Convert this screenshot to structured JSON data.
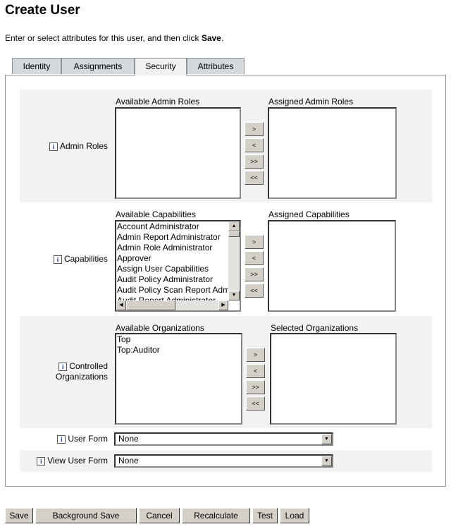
{
  "title": "Create User",
  "intro": {
    "text": "Enter or select attributes for this user, and then click ",
    "bold": "Save",
    "end": "."
  },
  "tabs": [
    {
      "label": "Identity"
    },
    {
      "label": "Assignments"
    },
    {
      "label": "Security",
      "active": true
    },
    {
      "label": "Attributes"
    }
  ],
  "admin_roles": {
    "label": "Admin Roles",
    "available_label": "Available Admin Roles",
    "assigned_label": "Assigned Admin Roles",
    "available": [],
    "assigned": []
  },
  "capabilities": {
    "label": "Capabilities",
    "available_label": "Available Capabilities",
    "assigned_label": "Assigned Capabilities",
    "available": [
      "Account Administrator",
      "Admin Report Administrator",
      "Admin Role Administrator",
      "Approver",
      "Assign User Capabilities",
      "Audit Policy Administrator",
      "Audit Policy Scan Report Administrator",
      "Audit Report Administrator"
    ],
    "assigned": []
  },
  "organizations": {
    "label1": "Controlled",
    "label2": "Organizations",
    "available_label": "Available Organizations",
    "assigned_label": "Selected Organizations",
    "available": [
      "Top",
      "Top:Auditor"
    ],
    "assigned": []
  },
  "move_buttons": [
    ">",
    "<",
    ">>",
    "<<"
  ],
  "user_form": {
    "label": "User Form",
    "value": "None"
  },
  "view_user_form": {
    "label": "View User Form",
    "value": "None"
  },
  "info_icon": "i",
  "footer_buttons": [
    "Save",
    "Background Save",
    "Cancel",
    "Recalculate",
    "Test",
    "Load"
  ]
}
